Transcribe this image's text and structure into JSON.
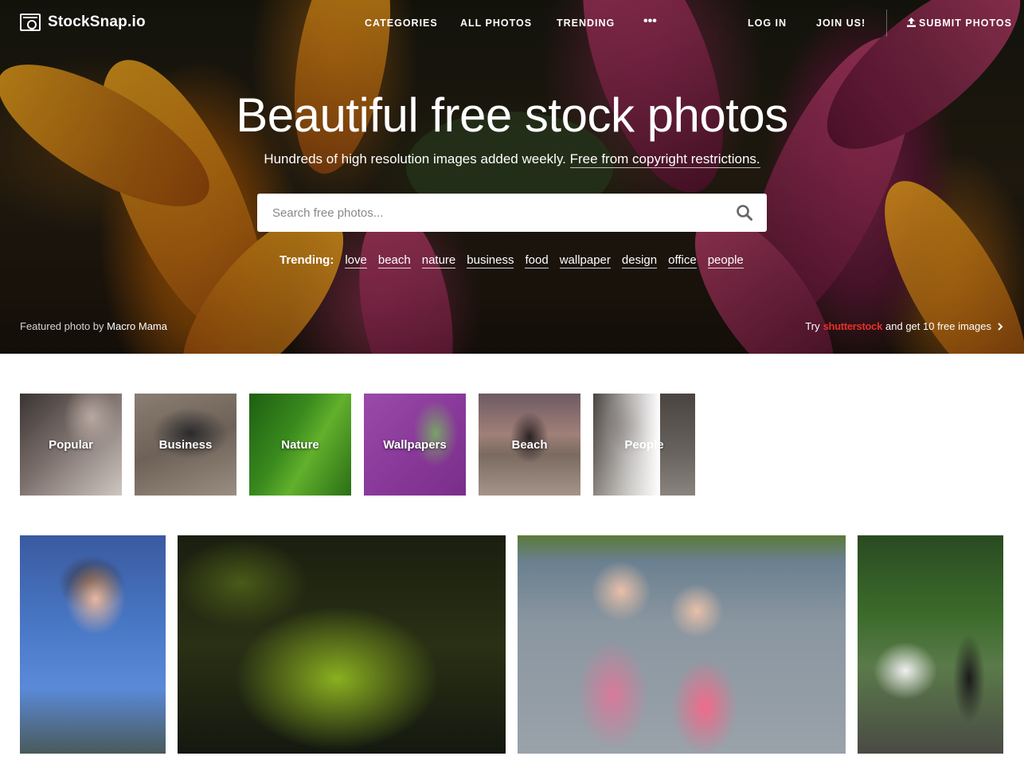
{
  "header": {
    "logo_text": "StockSnap.io",
    "nav": {
      "categories": "CATEGORIES",
      "all_photos": "ALL PHOTOS",
      "trending": "TRENDING",
      "more": "•••",
      "log_in": "LOG IN",
      "join_us": "JOIN US!",
      "submit_photos": "SUBMIT PHOTOS"
    }
  },
  "hero": {
    "headline": "Beautiful free stock photos",
    "subline_text": "Hundreds of high resolution images added weekly. ",
    "subline_link": "Free from copyright restrictions.",
    "search_placeholder": "Search free photos...",
    "trending_label": "Trending:",
    "trending_tags": [
      "love",
      "beach",
      "nature",
      "business",
      "food",
      "wallpaper",
      "design",
      "office",
      "people"
    ],
    "featured_prefix": "Featured photo by ",
    "featured_author": "Macro Mama",
    "promo_prefix": "Try ",
    "promo_brand": "shutterstock",
    "promo_suffix": "and get 10 free images"
  },
  "categories": [
    "Popular",
    "Business",
    "Nature",
    "Wallpapers",
    "Beach",
    "People"
  ],
  "colors": {
    "accent_red": "#e8302a",
    "nature_green": "#3a8a1e",
    "wallpaper_purple": "#8a3a9a"
  }
}
